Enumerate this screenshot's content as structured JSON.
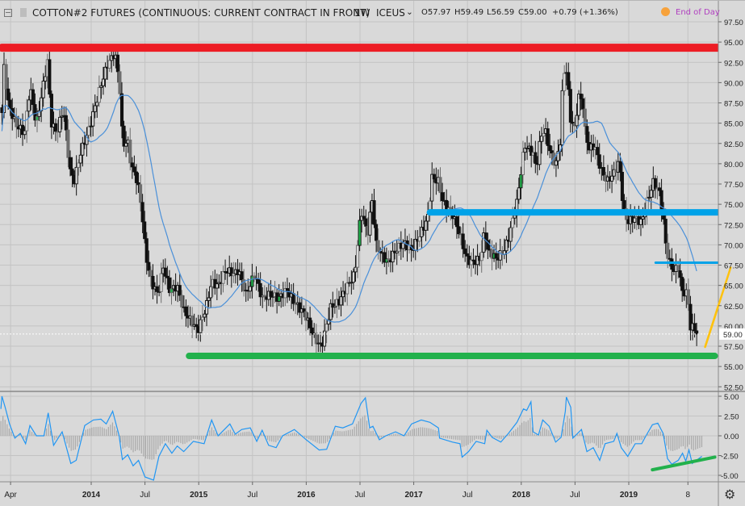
{
  "header": {
    "symbol_title": "COTTON#2 FUTURES (CONTINUOUS: CURRENT CONTRACT IN FRONT)",
    "interval": "1W",
    "exchange": "ICEUS",
    "open": "O57.97",
    "high": "H59.49",
    "low": "L56.59",
    "close": "C59.00",
    "change": "+0.79 (+1.36%)",
    "end_of_day": "End of Day",
    "icons": [
      "collapse-box-icon",
      "flag-icon",
      "chevron-down-icon",
      "end-of-day-dot-icon"
    ]
  },
  "settings_icon": "gear-icon",
  "colors": {
    "background": "#d9d9d9",
    "grid": "#c3c3c3",
    "moving_average": "#4a90d9",
    "indicator": "#2196f3",
    "red_line": "#ed1c24",
    "blue_line": "#00a2e8",
    "green_line": "#22b14c",
    "orange_line": "#ffc20e",
    "end_of_day": "#b040c0"
  },
  "chart_data": {
    "type": "candlestick",
    "title": "COTTON#2 FUTURES (CONTINUOUS: CURRENT CONTRACT IN FRONT)",
    "interval": "1W",
    "grid": true,
    "price_axis": {
      "range": [
        51.5,
        98.5
      ],
      "ticks": [
        "97.50",
        "95.00",
        "92.50",
        "90.00",
        "87.50",
        "85.00",
        "82.50",
        "80.00",
        "77.50",
        "75.00",
        "72.50",
        "70.00",
        "67.50",
        "65.00",
        "62.50",
        "60.00",
        "57.50",
        "55.00",
        "52.50"
      ]
    },
    "last_price": "59.00",
    "time_axis": {
      "ticks": [
        {
          "label": "Apr",
          "t": 2013.25
        },
        {
          "label": "2014",
          "t": 2014.0
        },
        {
          "label": "Jul",
          "t": 2014.5
        },
        {
          "label": "2015",
          "t": 2015.0
        },
        {
          "label": "Jul",
          "t": 2015.5
        },
        {
          "label": "2016",
          "t": 2016.0
        },
        {
          "label": "Jul",
          "t": 2016.5
        },
        {
          "label": "2017",
          "t": 2017.0
        },
        {
          "label": "Jul",
          "t": 2017.5
        },
        {
          "label": "2018",
          "t": 2018.0
        },
        {
          "label": "Jul",
          "t": 2018.5
        },
        {
          "label": "2019",
          "t": 2019.0
        },
        {
          "label": "8",
          "t": 2019.55
        }
      ]
    },
    "close_path": [
      [
        2013.17,
        86.3
      ],
      [
        2013.18,
        92.9
      ],
      [
        2013.23,
        87.3
      ],
      [
        2013.3,
        84.8
      ],
      [
        2013.38,
        83.8
      ],
      [
        2013.43,
        89.5
      ],
      [
        2013.49,
        84.8
      ],
      [
        2013.6,
        93.2
      ],
      [
        2013.62,
        85.3
      ],
      [
        2013.68,
        83.8
      ],
      [
        2013.74,
        86.8
      ],
      [
        2013.77,
        83.3
      ],
      [
        2013.8,
        79.3
      ],
      [
        2013.84,
        77.8
      ],
      [
        2013.9,
        81.3
      ],
      [
        2013.98,
        84.3
      ],
      [
        2014.04,
        87.3
      ],
      [
        2014.09,
        89.7
      ],
      [
        2014.15,
        92.2
      ],
      [
        2014.22,
        93.7
      ],
      [
        2014.26,
        90.2
      ],
      [
        2014.28,
        86.3
      ],
      [
        2014.29,
        82.3
      ],
      [
        2014.34,
        82.8
      ],
      [
        2014.37,
        79.8
      ],
      [
        2014.43,
        77.8
      ],
      [
        2014.47,
        74.3
      ],
      [
        2014.5,
        69.8
      ],
      [
        2014.52,
        67.8
      ],
      [
        2014.56,
        65.4
      ],
      [
        2014.62,
        63.9
      ],
      [
        2014.67,
        67.3
      ],
      [
        2014.73,
        64.4
      ],
      [
        2014.8,
        64.9
      ],
      [
        2014.86,
        61.9
      ],
      [
        2014.94,
        60.4
      ],
      [
        2014.99,
        59.4
      ],
      [
        2015.07,
        62.4
      ],
      [
        2015.12,
        65.4
      ],
      [
        2015.18,
        64.9
      ],
      [
        2015.25,
        66.9
      ],
      [
        2015.33,
        66.4
      ],
      [
        2015.37,
        66.9
      ],
      [
        2015.44,
        63.9
      ],
      [
        2015.52,
        66.4
      ],
      [
        2015.59,
        63.4
      ],
      [
        2015.67,
        63.9
      ],
      [
        2015.74,
        63.4
      ],
      [
        2015.82,
        64.4
      ],
      [
        2015.89,
        62.9
      ],
      [
        2015.99,
        61.4
      ],
      [
        2016.08,
        58.4
      ],
      [
        2016.14,
        57.4
      ],
      [
        2016.23,
        62.4
      ],
      [
        2016.3,
        62.9
      ],
      [
        2016.38,
        64.9
      ],
      [
        2016.45,
        66.4
      ],
      [
        2016.51,
        74.3
      ],
      [
        2016.57,
        71.3
      ],
      [
        2016.62,
        76.3
      ],
      [
        2016.64,
        70.3
      ],
      [
        2016.7,
        68.8
      ],
      [
        2016.76,
        67.8
      ],
      [
        2016.83,
        69.3
      ],
      [
        2016.91,
        70.3
      ],
      [
        2016.98,
        69.3
      ],
      [
        2017.06,
        71.3
      ],
      [
        2017.13,
        73.3
      ],
      [
        2017.17,
        78.3
      ],
      [
        2017.23,
        77.8
      ],
      [
        2017.27,
        75.3
      ],
      [
        2017.36,
        73.8
      ],
      [
        2017.43,
        71.3
      ],
      [
        2017.49,
        68.3
      ],
      [
        2017.54,
        67.8
      ],
      [
        2017.62,
        68.3
      ],
      [
        2017.66,
        71.8
      ],
      [
        2017.69,
        69.3
      ],
      [
        2017.77,
        68.3
      ],
      [
        2017.84,
        69.3
      ],
      [
        2017.88,
        70.8
      ],
      [
        2017.96,
        75.3
      ],
      [
        2017.99,
        78.3
      ],
      [
        2018.03,
        82.3
      ],
      [
        2018.07,
        81.8
      ],
      [
        2018.11,
        81.3
      ],
      [
        2018.14,
        79.3
      ],
      [
        2018.18,
        83.3
      ],
      [
        2018.22,
        84.3
      ],
      [
        2018.26,
        81.8
      ],
      [
        2018.32,
        79.8
      ],
      [
        2018.37,
        83.3
      ],
      [
        2018.38,
        88.3
      ],
      [
        2018.41,
        92.7
      ],
      [
        2018.43,
        90.2
      ],
      [
        2018.46,
        85.3
      ],
      [
        2018.5,
        84.3
      ],
      [
        2018.53,
        88.3
      ],
      [
        2018.57,
        87.8
      ],
      [
        2018.59,
        84.3
      ],
      [
        2018.63,
        81.8
      ],
      [
        2018.68,
        82.3
      ],
      [
        2018.74,
        79.3
      ],
      [
        2018.8,
        77.8
      ],
      [
        2018.86,
        78.8
      ],
      [
        2018.91,
        80.3
      ],
      [
        2018.95,
        74.3
      ],
      [
        2018.99,
        72.8
      ],
      [
        2019.05,
        73.3
      ],
      [
        2019.12,
        72.8
      ],
      [
        2019.17,
        75.3
      ],
      [
        2019.23,
        77.8
      ],
      [
        2019.29,
        76.3
      ],
      [
        2019.32,
        73.3
      ],
      [
        2019.35,
        69.3
      ],
      [
        2019.38,
        67.8
      ],
      [
        2019.42,
        66.8
      ],
      [
        2019.46,
        67.3
      ],
      [
        2019.5,
        63.9
      ],
      [
        2019.53,
        64.4
      ],
      [
        2019.56,
        62.4
      ],
      [
        2019.57,
        59.8
      ],
      [
        2019.61,
        59.8
      ],
      [
        2019.65,
        59.0
      ]
    ],
    "indicator": {
      "ticks": [
        "5.00",
        "2.50",
        "0.00",
        "-2.50",
        "-5.00"
      ],
      "range": [
        -6.5,
        5.5
      ],
      "points": [
        [
          2013.16,
          3.4
        ],
        [
          2013.17,
          5.0
        ],
        [
          2013.2,
          3.6
        ],
        [
          2013.24,
          1.5
        ],
        [
          2013.29,
          -0.3
        ],
        [
          2013.34,
          0.3
        ],
        [
          2013.39,
          -1.0
        ],
        [
          2013.43,
          1.3
        ],
        [
          2013.49,
          0.0
        ],
        [
          2013.56,
          0.0
        ],
        [
          2013.6,
          2.9
        ],
        [
          2013.65,
          -1.2
        ],
        [
          2013.73,
          0.5
        ],
        [
          2013.81,
          -3.5
        ],
        [
          2013.86,
          -3.1
        ],
        [
          2013.94,
          1.3
        ],
        [
          2014.02,
          2.0
        ],
        [
          2014.09,
          2.1
        ],
        [
          2014.14,
          1.5
        ],
        [
          2014.2,
          3.1
        ],
        [
          2014.26,
          0.0
        ],
        [
          2014.29,
          -3.0
        ],
        [
          2014.34,
          -2.4
        ],
        [
          2014.39,
          -3.8
        ],
        [
          2014.44,
          -3.1
        ],
        [
          2014.5,
          -5.2
        ],
        [
          2014.58,
          -5.6
        ],
        [
          2014.63,
          -2.6
        ],
        [
          2014.69,
          -1.0
        ],
        [
          2014.75,
          -2.2
        ],
        [
          2014.8,
          -1.3
        ],
        [
          2014.86,
          -2.0
        ],
        [
          2014.95,
          -0.7
        ],
        [
          2015.05,
          -1.0
        ],
        [
          2015.12,
          2.0
        ],
        [
          2015.18,
          0.0
        ],
        [
          2015.29,
          1.5
        ],
        [
          2015.34,
          0.2
        ],
        [
          2015.4,
          0.8
        ],
        [
          2015.48,
          1.0
        ],
        [
          2015.54,
          -0.7
        ],
        [
          2015.59,
          0.7
        ],
        [
          2015.65,
          -1.2
        ],
        [
          2015.72,
          -1.5
        ],
        [
          2015.78,
          0.0
        ],
        [
          2015.89,
          0.8
        ],
        [
          2016.0,
          -0.5
        ],
        [
          2016.12,
          -1.8
        ],
        [
          2016.19,
          -1.7
        ],
        [
          2016.27,
          1.2
        ],
        [
          2016.34,
          1.0
        ],
        [
          2016.43,
          1.5
        ],
        [
          2016.51,
          4.1
        ],
        [
          2016.55,
          4.8
        ],
        [
          2016.59,
          1.0
        ],
        [
          2016.62,
          1.2
        ],
        [
          2016.68,
          -0.5
        ],
        [
          2016.74,
          0.0
        ],
        [
          2016.83,
          0.5
        ],
        [
          2016.91,
          0.0
        ],
        [
          2016.98,
          1.5
        ],
        [
          2017.07,
          2.0
        ],
        [
          2017.15,
          1.7
        ],
        [
          2017.23,
          1.0
        ],
        [
          2017.24,
          -0.3
        ],
        [
          2017.36,
          -0.8
        ],
        [
          2017.43,
          -1.0
        ],
        [
          2017.45,
          -2.7
        ],
        [
          2017.51,
          -2.0
        ],
        [
          2017.58,
          -0.7
        ],
        [
          2017.66,
          -1.0
        ],
        [
          2017.68,
          0.7
        ],
        [
          2017.73,
          -0.2
        ],
        [
          2017.81,
          -0.8
        ],
        [
          2017.88,
          0.3
        ],
        [
          2017.96,
          1.7
        ],
        [
          2018.02,
          3.4
        ],
        [
          2018.05,
          3.2
        ],
        [
          2018.09,
          4.3
        ],
        [
          2018.11,
          0.5
        ],
        [
          2018.16,
          0.1
        ],
        [
          2018.2,
          2.0
        ],
        [
          2018.26,
          1.2
        ],
        [
          2018.32,
          -0.8
        ],
        [
          2018.37,
          -0.2
        ],
        [
          2018.41,
          3.1
        ],
        [
          2018.42,
          4.9
        ],
        [
          2018.46,
          3.6
        ],
        [
          2018.48,
          -0.3
        ],
        [
          2018.56,
          0.8
        ],
        [
          2018.61,
          -2.0
        ],
        [
          2018.67,
          -1.5
        ],
        [
          2018.73,
          -3.1
        ],
        [
          2018.78,
          -1.0
        ],
        [
          2018.86,
          -0.7
        ],
        [
          2018.89,
          0.3
        ],
        [
          2018.93,
          -1.5
        ],
        [
          2018.99,
          -2.6
        ],
        [
          2019.06,
          -1.0
        ],
        [
          2019.12,
          -1.0
        ],
        [
          2019.16,
          0.0
        ],
        [
          2019.22,
          1.4
        ],
        [
          2019.27,
          1.6
        ],
        [
          2019.32,
          0.3
        ],
        [
          2019.36,
          -2.9
        ],
        [
          2019.4,
          -3.6
        ],
        [
          2019.46,
          -3.1
        ],
        [
          2019.5,
          -2.2
        ],
        [
          2019.53,
          -3.2
        ],
        [
          2019.56,
          -1.8
        ],
        [
          2019.59,
          -3.5
        ],
        [
          2019.65,
          -2.9
        ],
        [
          2019.68,
          -2.6
        ]
      ]
    },
    "drawings": [
      {
        "name": "red-resistance-line",
        "color": "#ed1c24",
        "from": [
          2013.17,
          94.3
        ],
        "to": [
          2020.0,
          94.3
        ]
      },
      {
        "name": "blue-level-line",
        "color": "#00a2e8",
        "from": [
          2017.15,
          74.0
        ],
        "to": [
          2019.84,
          74.0
        ]
      },
      {
        "name": "blue-thin-level-line",
        "color": "#00a2e8",
        "from": [
          2019.25,
          67.8
        ],
        "to": [
          2019.84,
          67.8
        ]
      },
      {
        "name": "green-support-line",
        "color": "#22b14c",
        "from": [
          2014.91,
          56.3
        ],
        "to": [
          2019.8,
          56.3
        ]
      },
      {
        "name": "orange-trend-line",
        "color": "#ffc20e",
        "from": [
          2019.71,
          57.4
        ],
        "to": [
          2019.95,
          67.3
        ]
      },
      {
        "name": "green-indicator-trend-line",
        "color": "#22b14c",
        "pane": "indicator",
        "from": [
          2019.22,
          -4.3
        ],
        "to": [
          2019.8,
          -2.7
        ]
      }
    ]
  }
}
